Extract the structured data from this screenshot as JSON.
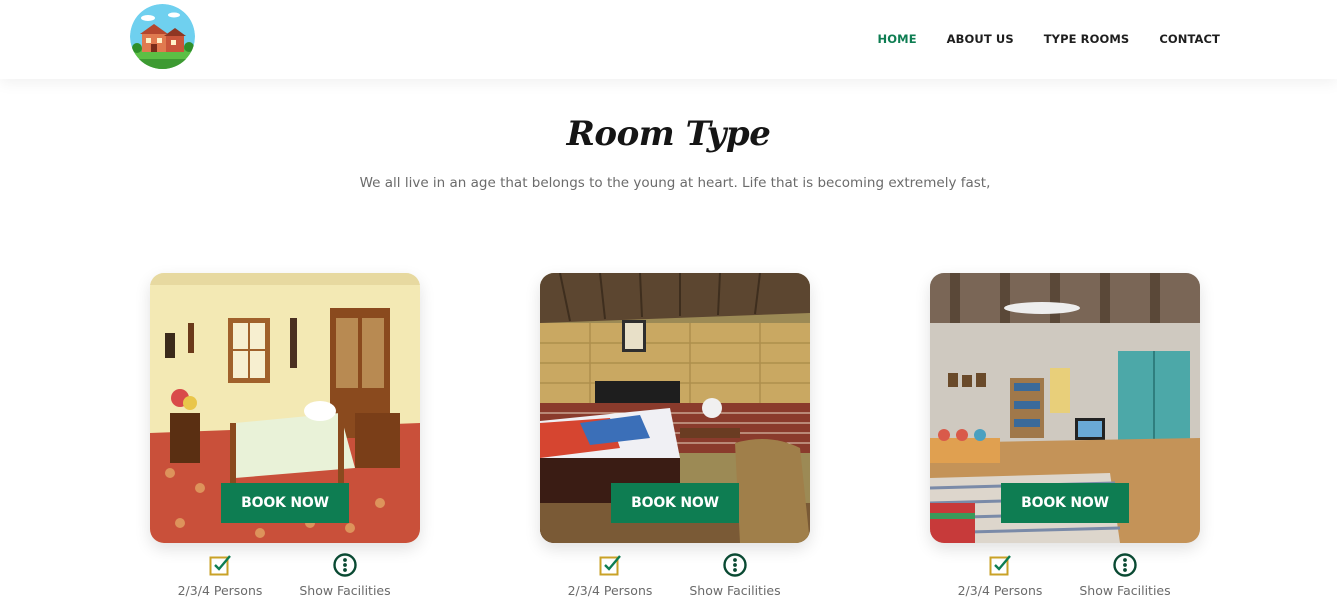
{
  "nav": {
    "logo": "house-logo",
    "items": [
      {
        "label": "HOME",
        "active": true
      },
      {
        "label": "ABOUT US",
        "active": false
      },
      {
        "label": "TYPE ROOMS",
        "active": false
      },
      {
        "label": "CONTACT",
        "active": false
      }
    ]
  },
  "section": {
    "title": "Room Type",
    "subtitle": "We all live in an age that belongs to the young at heart. Life that is becoming extremely fast,"
  },
  "rooms": [
    {
      "button": "BOOK NOW",
      "persons": "2/3/4 Persons",
      "facilities": "Show Facilities"
    },
    {
      "button": "BOOK NOW",
      "persons": "2/3/4 Persons",
      "facilities": "Show Facilities"
    },
    {
      "button": "BOOK NOW",
      "persons": "2/3/4 Persons",
      "facilities": "Show Facilities"
    }
  ],
  "colors": {
    "accent": "#0e7d52",
    "check_icon": "#c9a227",
    "text_muted": "#6b6b6b"
  },
  "icons": {
    "persons": "check-square-icon",
    "facilities": "info-circle-icon"
  }
}
